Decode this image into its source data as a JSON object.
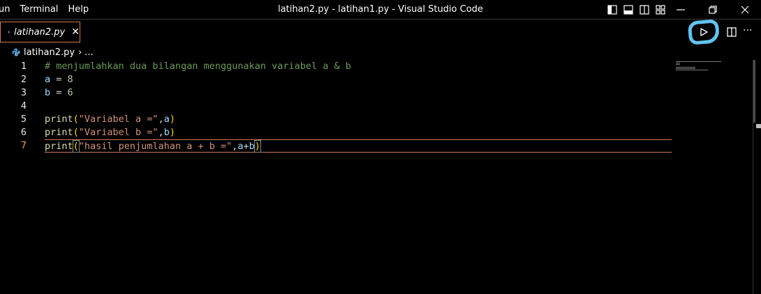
{
  "menu": [
    "un",
    "Terminal",
    "Help"
  ],
  "window_title": "latihan2.py - latihan1.py - Visual Studio Code",
  "layout_controls": [
    "toggle-primary-sidebar-icon",
    "toggle-panel-icon",
    "toggle-secondary-sidebar-icon",
    "customize-layout-icon"
  ],
  "window_controls": [
    "minimize-icon",
    "restore-icon",
    "close-icon"
  ],
  "tab": {
    "label": "latihan2.py",
    "close": "✕",
    "icon": "python-icon"
  },
  "editor_actions": {
    "run": "run-python-file-icon",
    "split": "split-editor-icon",
    "more": "···"
  },
  "breadcrumb": {
    "file": "latihan2.py",
    "ellipsis": "...",
    "separator": "›"
  },
  "active_line": 7,
  "code_lines": [
    {
      "num": "1",
      "tokens": [
        {
          "t": "# menjumlahkan dua bilangan menggunakan variabel a & b",
          "c": "comment"
        }
      ]
    },
    {
      "num": "2",
      "tokens": [
        {
          "t": "a",
          "c": "var"
        },
        {
          "t": " = ",
          "c": "op"
        },
        {
          "t": "8",
          "c": "num"
        }
      ]
    },
    {
      "num": "3",
      "tokens": [
        {
          "t": "b",
          "c": "var"
        },
        {
          "t": " = ",
          "c": "op"
        },
        {
          "t": "6",
          "c": "num"
        }
      ]
    },
    {
      "num": "4",
      "tokens": []
    },
    {
      "num": "5",
      "tokens": [
        {
          "t": "print",
          "c": "fn"
        },
        {
          "t": "(",
          "c": "paren"
        },
        {
          "t": "\"Variabel a =\"",
          "c": "str"
        },
        {
          "t": ",",
          "c": "op"
        },
        {
          "t": "a",
          "c": "var"
        },
        {
          "t": ")",
          "c": "paren"
        }
      ]
    },
    {
      "num": "6",
      "tokens": [
        {
          "t": "print",
          "c": "fn"
        },
        {
          "t": "(",
          "c": "paren"
        },
        {
          "t": "\"Variabel b =\"",
          "c": "str"
        },
        {
          "t": ",",
          "c": "op"
        },
        {
          "t": "b",
          "c": "var"
        },
        {
          "t": ")",
          "c": "paren"
        }
      ]
    },
    {
      "num": "7",
      "tokens": [
        {
          "t": "print",
          "c": "fn"
        },
        {
          "t": "(",
          "c": "paren",
          "match": true
        },
        {
          "t": "\"hasil penjumlahan a + b =\"",
          "c": "str"
        },
        {
          "t": ",",
          "c": "op"
        },
        {
          "t": "a",
          "c": "var"
        },
        {
          "t": "+",
          "c": "op"
        },
        {
          "t": "b",
          "c": "var"
        },
        {
          "t": ")",
          "c": "paren",
          "match": true,
          "cursor_after": true
        }
      ]
    }
  ],
  "colors": {
    "background": "#000000",
    "tab_border": "#d07a55",
    "run_highlight": "#61c3f0",
    "comment": "#6a9955",
    "string": "#ce9178",
    "function": "#dcdcaa",
    "variable": "#9cdcfe",
    "number": "#b5cea8"
  }
}
